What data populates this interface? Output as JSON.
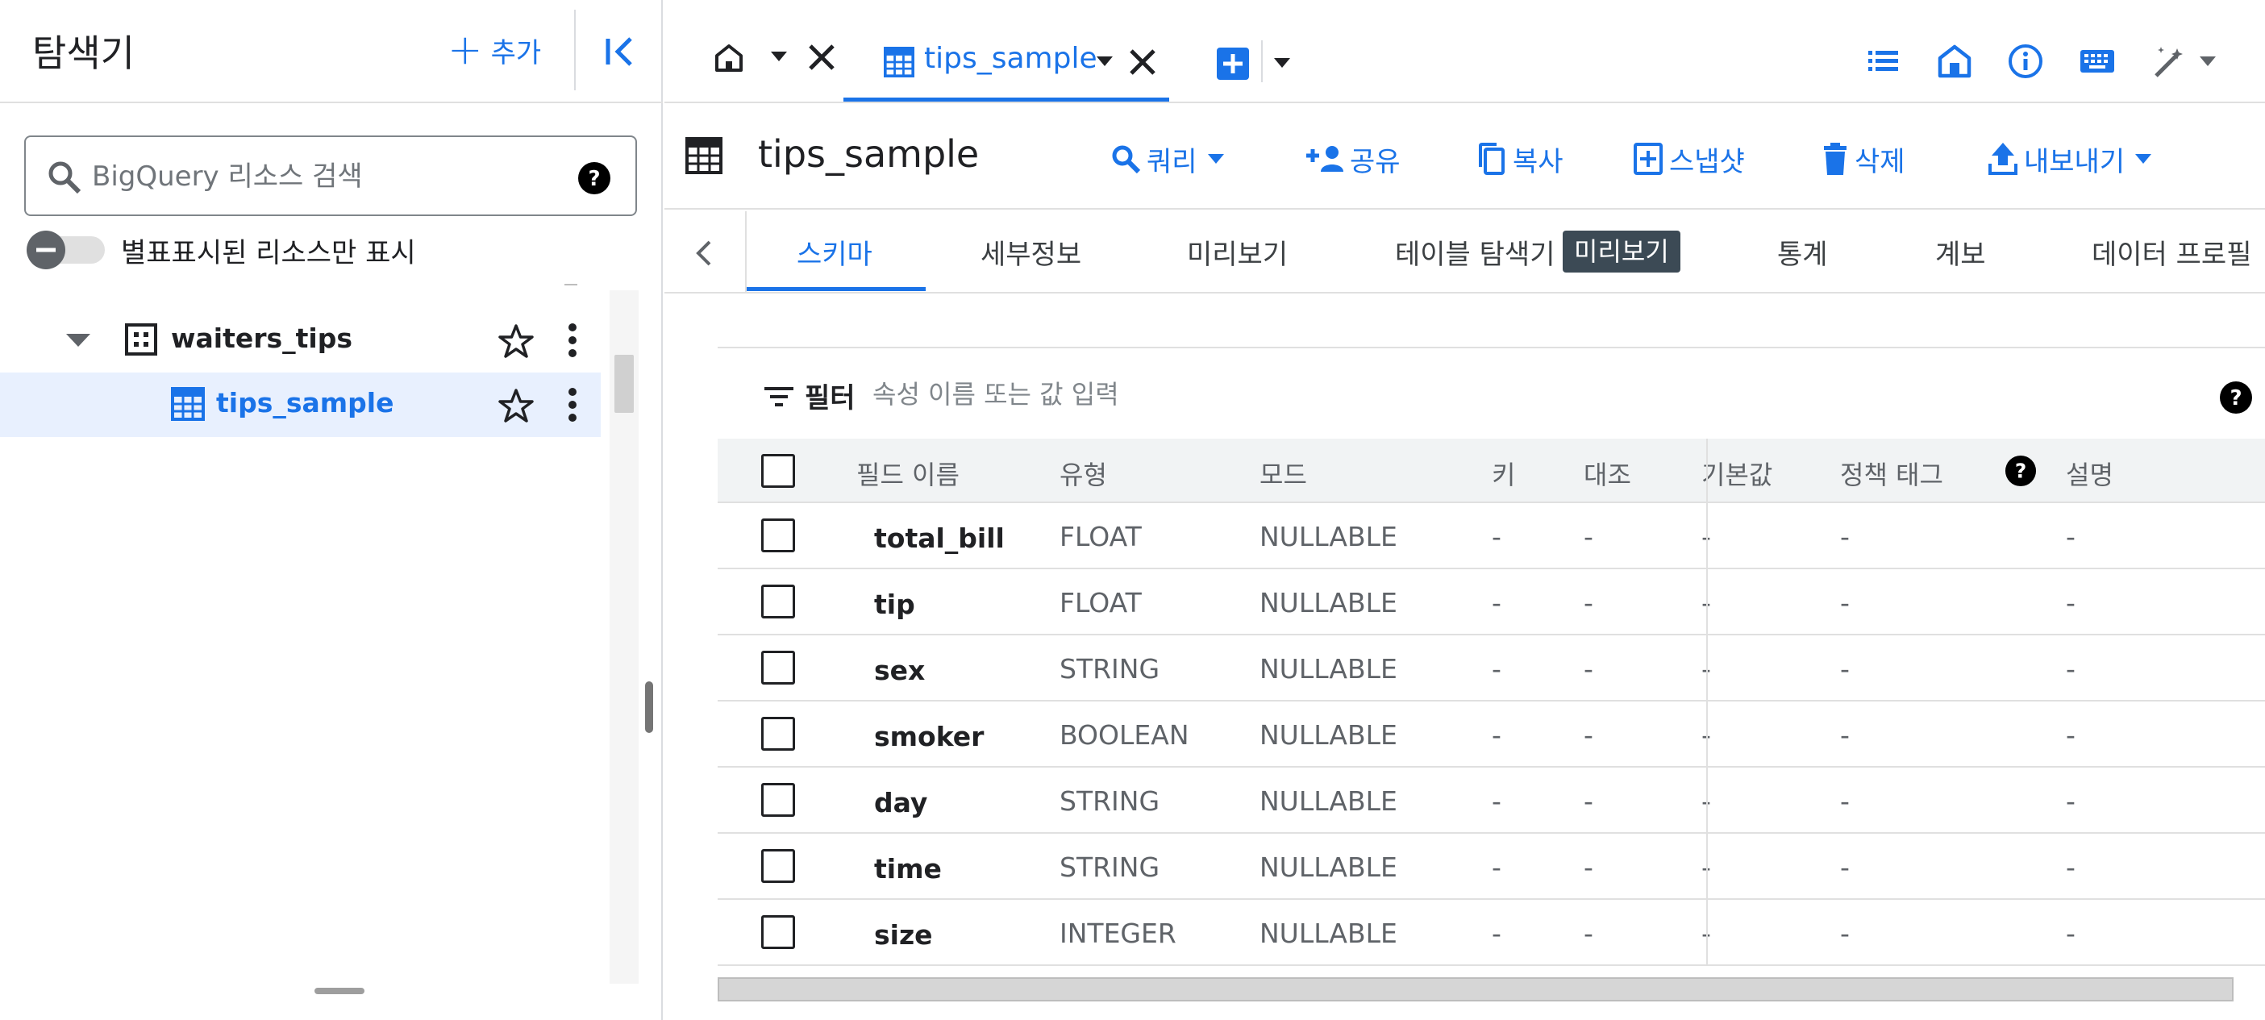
{
  "explorer": {
    "title": "탐색기",
    "add_label": "추가",
    "search_placeholder": "BigQuery 리소스 검색",
    "starred_only_label": "별표표시된 리소스만 표시",
    "tree": [
      {
        "label": "waiters_tips",
        "type": "dataset",
        "expanded": true
      },
      {
        "label": "tips_sample",
        "type": "table",
        "selected": true
      }
    ]
  },
  "tabs": {
    "active_tab_label": "tips_sample"
  },
  "table": {
    "title": "tips_sample",
    "actions": {
      "query": "쿼리",
      "share": "공유",
      "copy": "복사",
      "snapshot": "스냅샷",
      "delete": "삭제",
      "export": "내보내기"
    }
  },
  "subtabs": {
    "schema": "스키마",
    "details": "세부정보",
    "preview": "미리보기",
    "table_explorer": "테이블 탐색기",
    "table_explorer_badge": "미리보기",
    "stats": "통계",
    "lineage": "계보",
    "data_profile": "데이터 프로필"
  },
  "filter": {
    "label": "필터",
    "placeholder": "속성 이름 또는 값 입력"
  },
  "schema": {
    "headers": {
      "field_name": "필드 이름",
      "type": "유형",
      "mode": "모드",
      "key": "키",
      "collation": "대조",
      "default": "기본값",
      "policy_tags": "정책 태그",
      "description": "설명"
    },
    "rows": [
      {
        "name": "total_bill",
        "type": "FLOAT",
        "mode": "NULLABLE",
        "key": "-",
        "collation": "-",
        "default": "-",
        "policy_tags": "-",
        "description": "-"
      },
      {
        "name": "tip",
        "type": "FLOAT",
        "mode": "NULLABLE",
        "key": "-",
        "collation": "-",
        "default": "-",
        "policy_tags": "-",
        "description": "-"
      },
      {
        "name": "sex",
        "type": "STRING",
        "mode": "NULLABLE",
        "key": "-",
        "collation": "-",
        "default": "-",
        "policy_tags": "-",
        "description": "-"
      },
      {
        "name": "smoker",
        "type": "BOOLEAN",
        "mode": "NULLABLE",
        "key": "-",
        "collation": "-",
        "default": "-",
        "policy_tags": "-",
        "description": "-"
      },
      {
        "name": "day",
        "type": "STRING",
        "mode": "NULLABLE",
        "key": "-",
        "collation": "-",
        "default": "-",
        "policy_tags": "-",
        "description": "-"
      },
      {
        "name": "time",
        "type": "STRING",
        "mode": "NULLABLE",
        "key": "-",
        "collation": "-",
        "default": "-",
        "policy_tags": "-",
        "description": "-"
      },
      {
        "name": "size",
        "type": "INTEGER",
        "mode": "NULLABLE",
        "key": "-",
        "collation": "-",
        "default": "-",
        "policy_tags": "-",
        "description": "-"
      }
    ]
  },
  "colors": {
    "accent": "#1a73e8",
    "selected_row": "#e8f0fe",
    "text": "#202124",
    "muted": "#5f6368",
    "header_bg": "#f1f3f4"
  }
}
